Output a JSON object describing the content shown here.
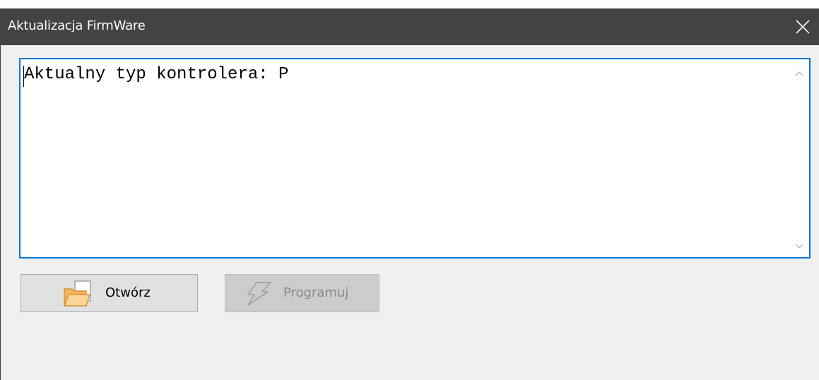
{
  "window": {
    "title": "Aktualizacja FirmWare"
  },
  "log": {
    "text": "Aktualny typ kontrolera: P"
  },
  "buttons": {
    "open_label": "Otwórz",
    "program_label": "Programuj"
  },
  "icons": {
    "close": "close-icon",
    "open": "folder-icon",
    "program": "lightning-icon",
    "scroll_up": "chevron-up-icon",
    "scroll_down": "chevron-down-icon"
  },
  "colors": {
    "titlebar": "#434343",
    "focus_border": "#0078d7",
    "disabled_button": "#cccccc"
  }
}
